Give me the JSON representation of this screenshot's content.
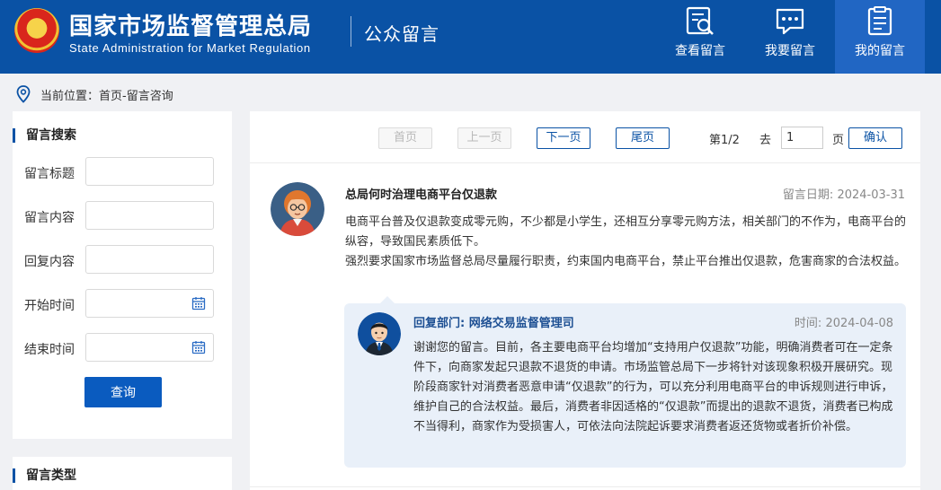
{
  "header": {
    "title_cn": "国家市场监督管理总局",
    "title_en": "State Administration for Market Regulation",
    "section": "公众留言",
    "nav": [
      {
        "label": "查看留言",
        "icon": "view-messages-icon"
      },
      {
        "label": "我要留言",
        "icon": "chat-icon"
      },
      {
        "label": "我的留言",
        "icon": "clipboard-icon",
        "active": true
      }
    ],
    "brand_color": "#0a52a5"
  },
  "breadcrumb": {
    "prefix": "当前位置：",
    "path": "首页-留言咨询"
  },
  "sidebar": {
    "search": {
      "heading": "留言搜索",
      "fields": [
        {
          "label": "留言标题",
          "value": "",
          "icon": null
        },
        {
          "label": "留言内容",
          "value": "",
          "icon": null
        },
        {
          "label": "回复内容",
          "value": "",
          "icon": null
        },
        {
          "label": "开始时间",
          "value": "",
          "icon": "calendar-icon"
        },
        {
          "label": "结束时间",
          "value": "",
          "icon": "calendar-icon"
        }
      ],
      "button": "查询"
    },
    "types": {
      "heading": "留言类型"
    }
  },
  "pager": {
    "first": "首页",
    "prev": "上一页",
    "next": "下一页",
    "last": "尾页",
    "page_info": "第1/2",
    "goto_label": "去",
    "goto_value": "1",
    "page_unit": "页",
    "confirm": "确认"
  },
  "message": {
    "title": "总局何时治理电商平台仅退款",
    "date_label": "留言日期:",
    "date": "2024-03-31",
    "paragraphs": [
      "电商平台普及仅退款变成零元购，不少都是小学生，还相互分享零元购方法，相关部门的不作为，电商平台的纵容，导致国民素质低下。",
      "强烈要求国家市场监督总局尽量履行职责，约束国内电商平台，禁止平台推出仅退款，危害商家的合法权益。"
    ],
    "reply": {
      "dept_label": "回复部门:",
      "dept": "网络交易监督管理司",
      "time_label": "时间:",
      "time": "2024-04-08",
      "body": "谢谢您的留言。目前，各主要电商平台均增加“支持用户仅退款”功能，明确消费者可在一定条件下，向商家发起只退款不退货的申请。市场监管总局下一步将针对该现象积极开展研究。现阶段商家针对消费者恶意申请“仅退款”的行为，可以充分利用电商平台的申诉规则进行申诉，维护自己的合法权益。最后，消费者非因适格的“仅退款”而提出的退款不退货，消费者已构成不当得利，商家作为受损害人，可依法向法院起诉要求消费者返还货物或者折价补偿。"
    }
  }
}
